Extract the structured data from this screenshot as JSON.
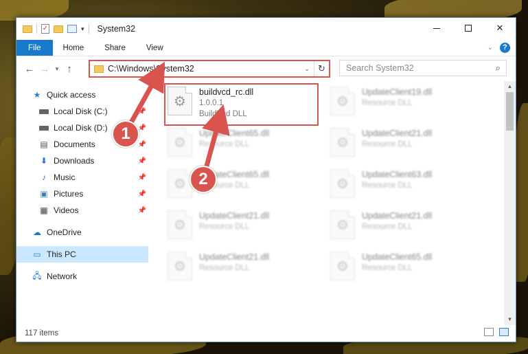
{
  "window": {
    "title": "System32"
  },
  "ribbon": {
    "tabs": [
      "File",
      "Home",
      "Share",
      "View"
    ],
    "help": "?"
  },
  "address": {
    "path": "C:\\Windows\\System32",
    "search_placeholder": "Search System32"
  },
  "sidebar": {
    "items": [
      {
        "label": "Quick access",
        "icon": "star-icon",
        "pinned": false
      },
      {
        "label": "Local Disk (C:)",
        "icon": "drive-icon",
        "pinned": true
      },
      {
        "label": "Local Disk (D:)",
        "icon": "drive-icon",
        "pinned": true
      },
      {
        "label": "Documents",
        "icon": "documents-icon",
        "pinned": true
      },
      {
        "label": "Downloads",
        "icon": "download-icon",
        "pinned": true
      },
      {
        "label": "Music",
        "icon": "music-icon",
        "pinned": true
      },
      {
        "label": "Pictures",
        "icon": "pictures-icon",
        "pinned": true
      },
      {
        "label": "Videos",
        "icon": "videos-icon",
        "pinned": true
      },
      {
        "label": "OneDrive",
        "icon": "cloud-icon",
        "pinned": false
      },
      {
        "label": "This PC",
        "icon": "computer-icon",
        "pinned": false
      },
      {
        "label": "Network",
        "icon": "network-icon",
        "pinned": false
      }
    ]
  },
  "files": {
    "highlighted": {
      "name": "buildvcd_rc.dll",
      "version": "1.0.0.1",
      "description": "BuildVcd DLL"
    },
    "left_column": [
      {
        "name": "UpdateClient65.dll",
        "description": "Resource DLL"
      },
      {
        "name": "UpdateClient65.dll",
        "description": "Resource DLL"
      },
      {
        "name": "UpdateClient21.dll",
        "description": "Resource DLL"
      },
      {
        "name": "UpdateClient21.dll",
        "description": "Resource DLL"
      }
    ],
    "right_column": [
      {
        "name": "UpdateClient19.dll",
        "description": "Resource DLL"
      },
      {
        "name": "UpdateClient21.dll",
        "description": "Resource DLL"
      },
      {
        "name": "UpdateClient63.dll",
        "description": "Resource DLL"
      },
      {
        "name": "UpdateClient21.dll",
        "description": "Resource DLL"
      },
      {
        "name": "UpdateClient65.dll",
        "description": "Resource DLL"
      }
    ]
  },
  "status": {
    "item_count": "117 items"
  },
  "annotations": {
    "step1": "1",
    "step2": "2",
    "color": "#d9534f"
  }
}
